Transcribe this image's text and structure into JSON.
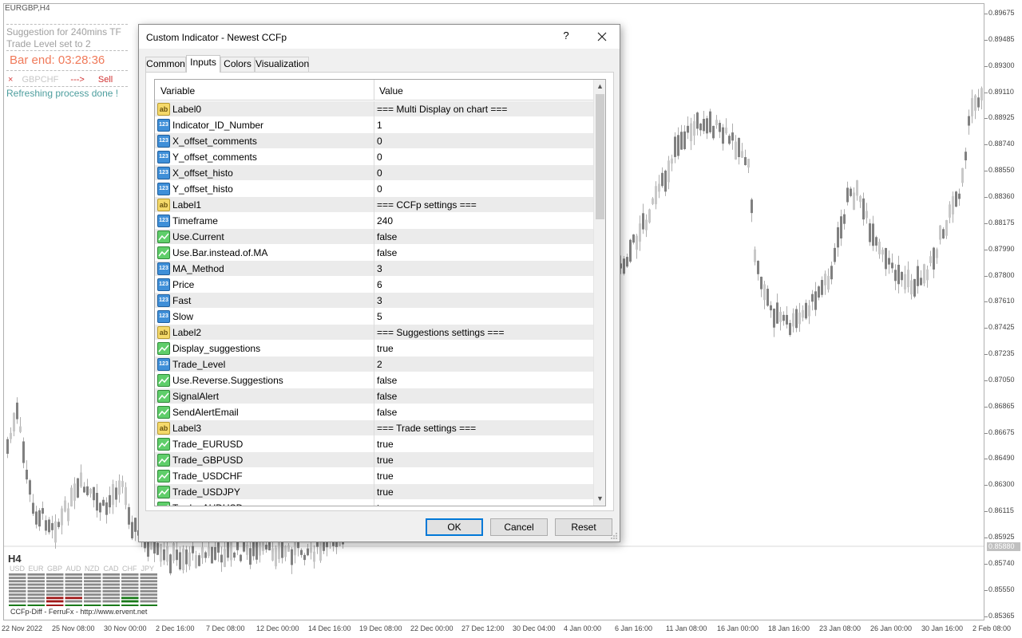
{
  "chart": {
    "symbol_title": "EURGBP,H4",
    "info": {
      "suggestion": "Suggestion for 240mins TF",
      "trade_level": "Trade Level set to 2",
      "bar_end": "Bar end: 03:28:36",
      "signal_marker": "×",
      "signal_pair": "GBPCHF",
      "signal_arrow": "--->",
      "signal_action": "Sell",
      "refresh": "Refreshing process done !"
    },
    "histo": {
      "timeframe": "H4",
      "currencies": [
        "USD",
        "EUR",
        "GBP",
        "AUD",
        "NZD",
        "CAD",
        "CHF",
        "JPY"
      ],
      "credits": "CCFp-Diff - FerruFx - http://www.ervent.net"
    },
    "price_axis": [
      "0.89675",
      "0.89485",
      "0.89300",
      "0.89110",
      "0.88925",
      "0.88740",
      "0.88550",
      "0.88360",
      "0.88175",
      "0.87990",
      "0.87800",
      "0.87610",
      "0.87425",
      "0.87235",
      "0.87050",
      "0.86865",
      "0.86675",
      "0.86490",
      "0.86300",
      "0.86115",
      "0.85925",
      "0.85740",
      "0.85550",
      "0.85365"
    ],
    "current_price": "0.85880",
    "time_axis": [
      "22 Nov 2022",
      "25 Nov 08:00",
      "30 Nov 00:00",
      "2 Dec 16:00",
      "7 Dec 08:00",
      "12 Dec 00:00",
      "14 Dec 16:00",
      "19 Dec 08:00",
      "22 Dec 00:00",
      "27 Dec 12:00",
      "30 Dec 04:00",
      "4 Jan 00:00",
      "6 Jan 16:00",
      "11 Jan 08:00",
      "16 Jan 00:00",
      "18 Jan 16:00",
      "23 Jan 08:00",
      "26 Jan 00:00",
      "30 Jan 16:00",
      "2 Feb 08:00"
    ],
    "colors": {
      "bull_candle": "#c8c8c8",
      "bear_candle": "#808080",
      "histo_up": "#1a7a1a",
      "histo_down": "#a01818"
    }
  },
  "dialog": {
    "title": "Custom Indicator - Newest CCFp",
    "help": "?",
    "tabs": [
      "Common",
      "Inputs",
      "Colors",
      "Visualization"
    ],
    "active_tab": "Inputs",
    "columns": {
      "variable": "Variable",
      "value": "Value"
    },
    "rows": [
      {
        "icon": "ab",
        "name": "Label0",
        "value": "=== Multi Display on chart ==="
      },
      {
        "icon": "num",
        "name": "Indicator_ID_Number",
        "value": "1"
      },
      {
        "icon": "num",
        "name": "X_offset_comments",
        "value": "0"
      },
      {
        "icon": "num",
        "name": "Y_offset_comments",
        "value": "0"
      },
      {
        "icon": "num",
        "name": "X_offset_histo",
        "value": "0"
      },
      {
        "icon": "num",
        "name": "Y_offset_histo",
        "value": "0"
      },
      {
        "icon": "ab",
        "name": "Label1",
        "value": "=== CCFp settings ==="
      },
      {
        "icon": "num",
        "name": "Timeframe",
        "value": "240"
      },
      {
        "icon": "bool",
        "name": "Use.Current",
        "value": "false"
      },
      {
        "icon": "bool",
        "name": "Use.Bar.instead.of.MA",
        "value": "false"
      },
      {
        "icon": "num",
        "name": "MA_Method",
        "value": "3"
      },
      {
        "icon": "num",
        "name": "Price",
        "value": "6"
      },
      {
        "icon": "num",
        "name": "Fast",
        "value": "3"
      },
      {
        "icon": "num",
        "name": "Slow",
        "value": "5"
      },
      {
        "icon": "ab",
        "name": "Label2",
        "value": "=== Suggestions settings ==="
      },
      {
        "icon": "bool",
        "name": "Display_suggestions",
        "value": "true"
      },
      {
        "icon": "num",
        "name": "Trade_Level",
        "value": "2"
      },
      {
        "icon": "bool",
        "name": "Use.Reverse.Suggestions",
        "value": "false"
      },
      {
        "icon": "bool",
        "name": "SignalAlert",
        "value": "false"
      },
      {
        "icon": "bool",
        "name": "SendAlertEmail",
        "value": "false"
      },
      {
        "icon": "ab",
        "name": "Label3",
        "value": "=== Trade settings ==="
      },
      {
        "icon": "bool",
        "name": "Trade_EURUSD",
        "value": "true"
      },
      {
        "icon": "bool",
        "name": "Trade_GBPUSD",
        "value": "true"
      },
      {
        "icon": "bool",
        "name": "Trade_USDCHF",
        "value": "true"
      },
      {
        "icon": "bool",
        "name": "Trade_USDJPY",
        "value": "true"
      },
      {
        "icon": "bool",
        "name": "Trade_AUDUSD",
        "value": "true"
      }
    ],
    "buttons": {
      "ok": "OK",
      "cancel": "Cancel",
      "reset": "Reset"
    }
  }
}
